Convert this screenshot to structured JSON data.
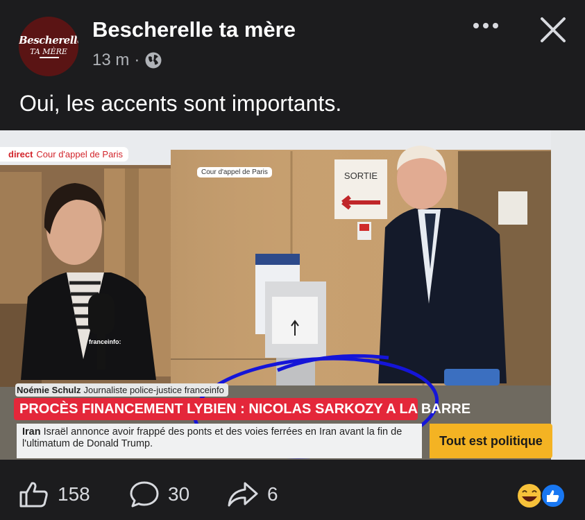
{
  "post": {
    "page_name": "Bescherelle ta mère",
    "avatar_line1": "Bescherelle",
    "avatar_line2": "TA MÈRE",
    "time": "13 m",
    "separator": "·",
    "privacy_icon": "globe-icon",
    "text": "Oui, les accents sont importants."
  },
  "tv": {
    "live_prefix": "direct",
    "live_location": "Cour d'appel de Paris",
    "venue_tag": "Cour d'appel de Paris",
    "reporter_name": "Noémie Schulz",
    "reporter_role": "Journaliste police-justice franceinfo",
    "headline": "PROCÈS FINANCEMENT LYBIEN : NICOLAS SARKOZY A LA BARRE",
    "ticker_topic": "Iran",
    "ticker_text": "Israël annonce avoir frappé des ponts et des voies ferrées en Iran avant la fin de l'ultimatum de Donald Trump.",
    "program": "Tout est politique",
    "mic_brand": "franceinfo:",
    "sign_text": "SORTIE"
  },
  "reactions": {
    "likes": "158",
    "comments": "30",
    "shares": "6",
    "like_icon": "thumbs-up-icon",
    "comment_icon": "comment-bubble-icon",
    "share_icon": "share-arrow-icon",
    "summary_icons": [
      "laughing-emoji-icon",
      "like-badge-icon"
    ]
  },
  "colors": {
    "background": "#1c1c1e",
    "headline_red": "#e4273a",
    "program_yellow": "#f4b323",
    "circle_blue": "#1515d8",
    "like_blue": "#1877f2"
  }
}
